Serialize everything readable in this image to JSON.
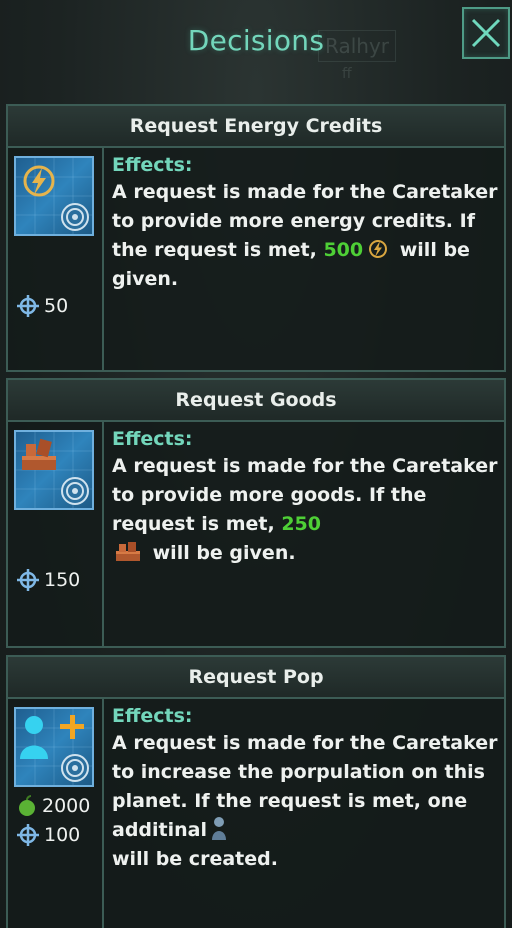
{
  "window": {
    "title": "Decisions",
    "background_label": "Ralhyr",
    "background_label_sub": "ff"
  },
  "decisions": [
    {
      "title": "Request Energy Credits",
      "icon": "energy-icon",
      "costs": [
        {
          "icon": "influence-icon",
          "value": "50"
        }
      ],
      "effects_label": "Effects:",
      "desc_before": "A request is made for the Caretaker to provide more energy credits. If the request is met,",
      "amount": "500",
      "resource_icon": "energy-icon",
      "desc_after": "will be given."
    },
    {
      "title": "Request Goods",
      "icon": "goods-icon",
      "costs": [
        {
          "icon": "influence-icon",
          "value": "150"
        }
      ],
      "effects_label": "Effects:",
      "desc_before": "A request is made for the Caretaker to provide more goods. If the request is met,",
      "amount": "250",
      "resource_icon": "goods-icon",
      "desc_after": "will be given."
    },
    {
      "title": "Request Pop",
      "icon": "pop-add-icon",
      "costs": [
        {
          "icon": "food-icon",
          "value": "2000"
        },
        {
          "icon": "influence-icon",
          "value": "100"
        }
      ],
      "effects_label": "Effects:",
      "desc_before": "A request is made for the Caretaker to increase the porpulation on this planet. If the request is met, one additinal",
      "amount": "",
      "resource_icon": "pop-icon",
      "desc_after": "will be created."
    }
  ],
  "colors": {
    "accent": "#73d6bb",
    "border": "#3c5c55",
    "positive": "#4ecf36",
    "icon_bg": "#2f84bc"
  }
}
